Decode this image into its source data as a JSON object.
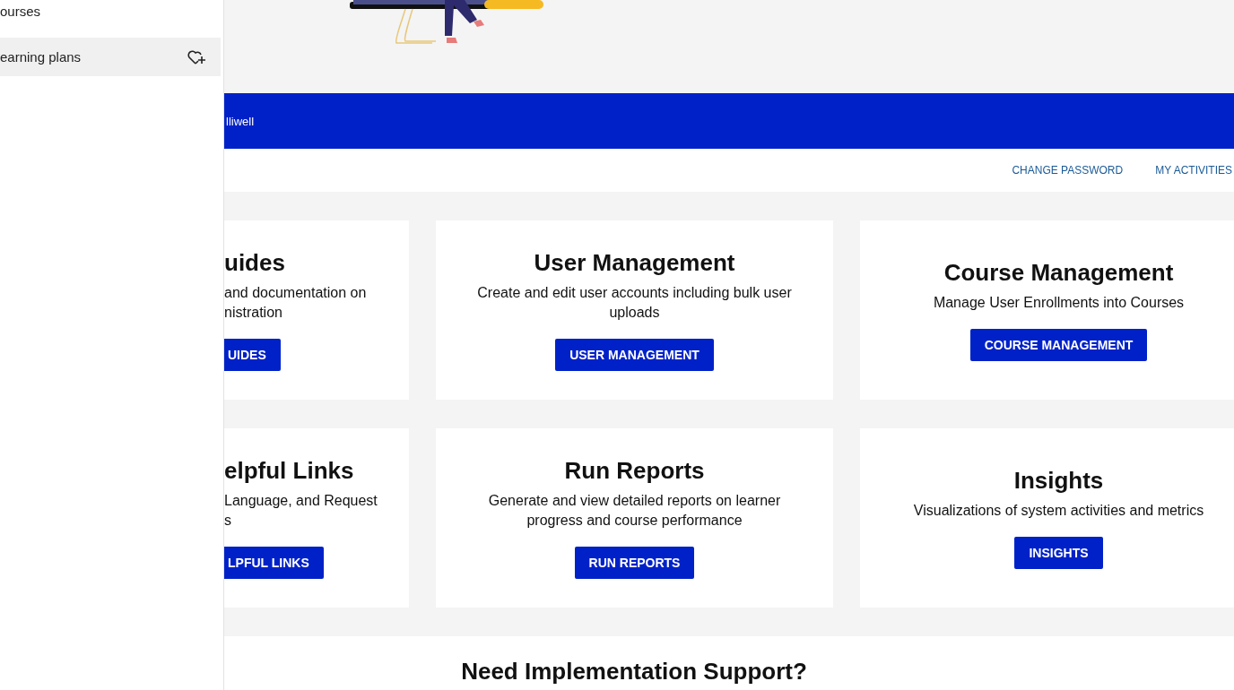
{
  "sidebar": {
    "items": [
      {
        "label": "ourses",
        "selected": false,
        "favorite_icon": false
      },
      {
        "label": "earning plans",
        "selected": true,
        "favorite_icon": true
      }
    ]
  },
  "banner": {
    "user_name": "lliwell"
  },
  "account_links": [
    "CHANGE PASSWORD",
    "MY ACTIVITIES"
  ],
  "cards": [
    {
      "kind": "cut",
      "title": "uides",
      "description_lines": [
        "and documentation on",
        "nistration"
      ],
      "button": "UIDES"
    },
    {
      "kind": "full",
      "title": "User Management",
      "description_lines": [
        "Create and edit user accounts including bulk user",
        "uploads"
      ],
      "button": "USER MANAGEMENT"
    },
    {
      "kind": "full",
      "title": "Course Management",
      "description_lines": [
        "Manage User Enrollments into Courses"
      ],
      "button": "COURSE MANAGEMENT"
    },
    {
      "kind": "cut",
      "title": "elpful Links",
      "description_lines": [
        "Language, and Request",
        "s"
      ],
      "button": "LPFUL LINKS"
    },
    {
      "kind": "full",
      "title": "Run Reports",
      "description_lines": [
        "Generate and view detailed reports on learner",
        "progress and course performance"
      ],
      "button": "RUN REPORTS"
    },
    {
      "kind": "full",
      "title": "Insights",
      "description_lines": [
        "Visualizations of system activities and metrics"
      ],
      "button": "INSIGHTS"
    }
  ],
  "support": {
    "heading": "Need Implementation Support?"
  }
}
